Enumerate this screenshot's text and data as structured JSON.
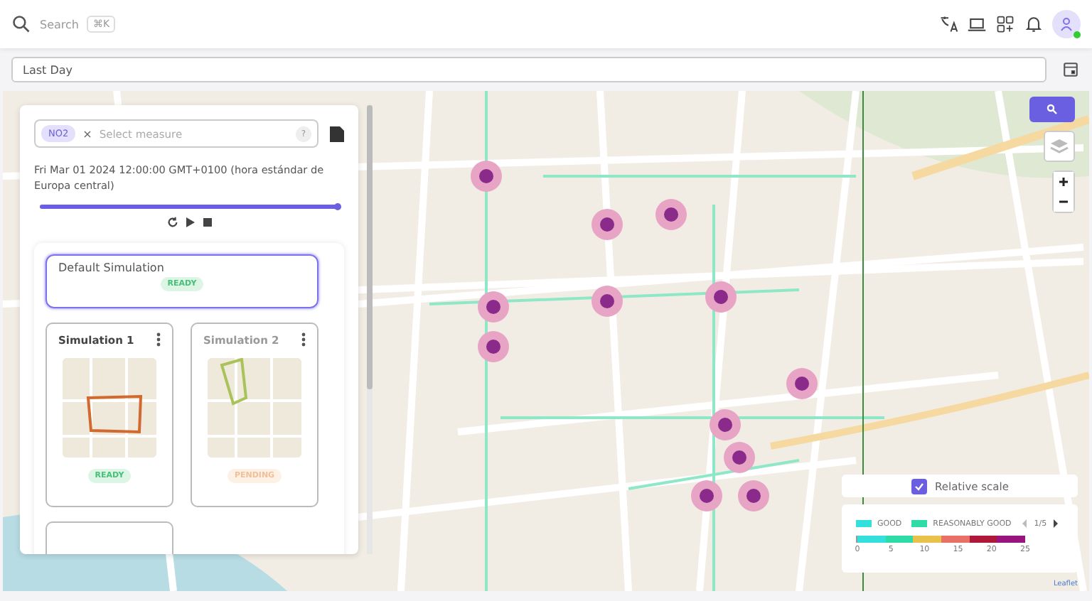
{
  "topbar": {
    "search_placeholder": "Search",
    "shortcut": "⌘K"
  },
  "date_filter": {
    "value": "Last Day"
  },
  "panel": {
    "measure_chip": "NO2",
    "remove": "×",
    "measure_placeholder": "Select measure",
    "help": "?",
    "timestamp": "Fri Mar 01 2024 12:00:00 GMT+0100 (hora estándar de Europa central)",
    "timeline": {
      "level": 1.0
    },
    "simulations": [
      {
        "kind": "default",
        "title": "Default Simulation",
        "status": "READY",
        "pending": false,
        "selected": true
      },
      {
        "kind": "card",
        "title": "Simulation 1",
        "status": "READY",
        "pending": false,
        "selected": false,
        "color": "#d2692e"
      },
      {
        "kind": "card",
        "title": "Simulation 2",
        "status": "PENDING",
        "pending": true,
        "selected": false,
        "color": "#a9c25a"
      },
      {
        "kind": "partial",
        "selected": false
      }
    ]
  },
  "relative_scale": {
    "label": "Relative scale",
    "checked": true
  },
  "legend": {
    "items": [
      {
        "label": "GOOD",
        "color": "#33e0dc"
      },
      {
        "label": "REASONABLY GOOD",
        "color": "#2fdca8"
      }
    ],
    "page": "1/5",
    "segments": [
      {
        "color": "#33e0dc"
      },
      {
        "color": "#2fdca8"
      },
      {
        "color": "#e8c24a"
      },
      {
        "color": "#e87066"
      },
      {
        "color": "#b0183a"
      },
      {
        "color": "#9a1480"
      }
    ],
    "ticks": [
      "0",
      "5",
      "10",
      "15",
      "20",
      "25"
    ]
  },
  "attribution": "Leaflet"
}
